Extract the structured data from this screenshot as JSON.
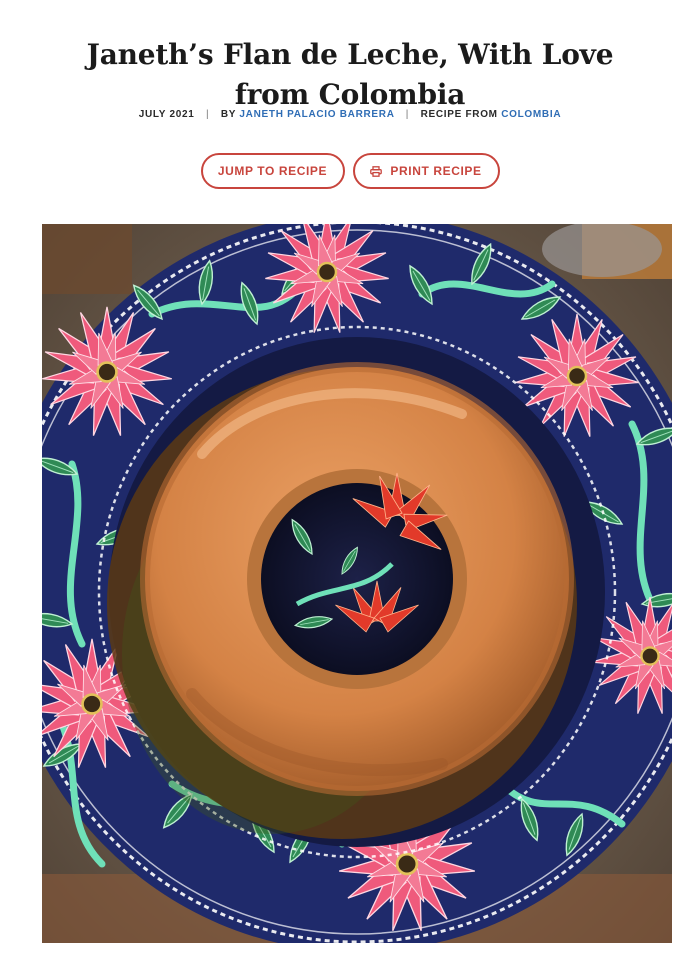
{
  "article": {
    "title": "Janeth’s Flan de Leche, With Love from Colombia",
    "date": "JULY 2021",
    "by_prefix": "BY",
    "author": "JANETH PALACIO BARRERA",
    "recipe_from_prefix": "RECIPE FROM",
    "country": "COLOMBIA"
  },
  "actions": {
    "jump_label": "JUMP TO RECIPE",
    "print_label": "PRINT RECIPE",
    "print_icon": "printer-icon"
  },
  "photo": {
    "subject": "flan-on-poinsettia-plate",
    "colors": {
      "plate_blue": "#1f2a6b",
      "flower_pink": "#ef5a7c",
      "leaf_green": "#2f8a55",
      "vine_mint": "#6fe0b8",
      "flan_caramel": "#d9874a"
    }
  },
  "colors": {
    "accent": "#c8453d",
    "link": "#2f6db5"
  }
}
